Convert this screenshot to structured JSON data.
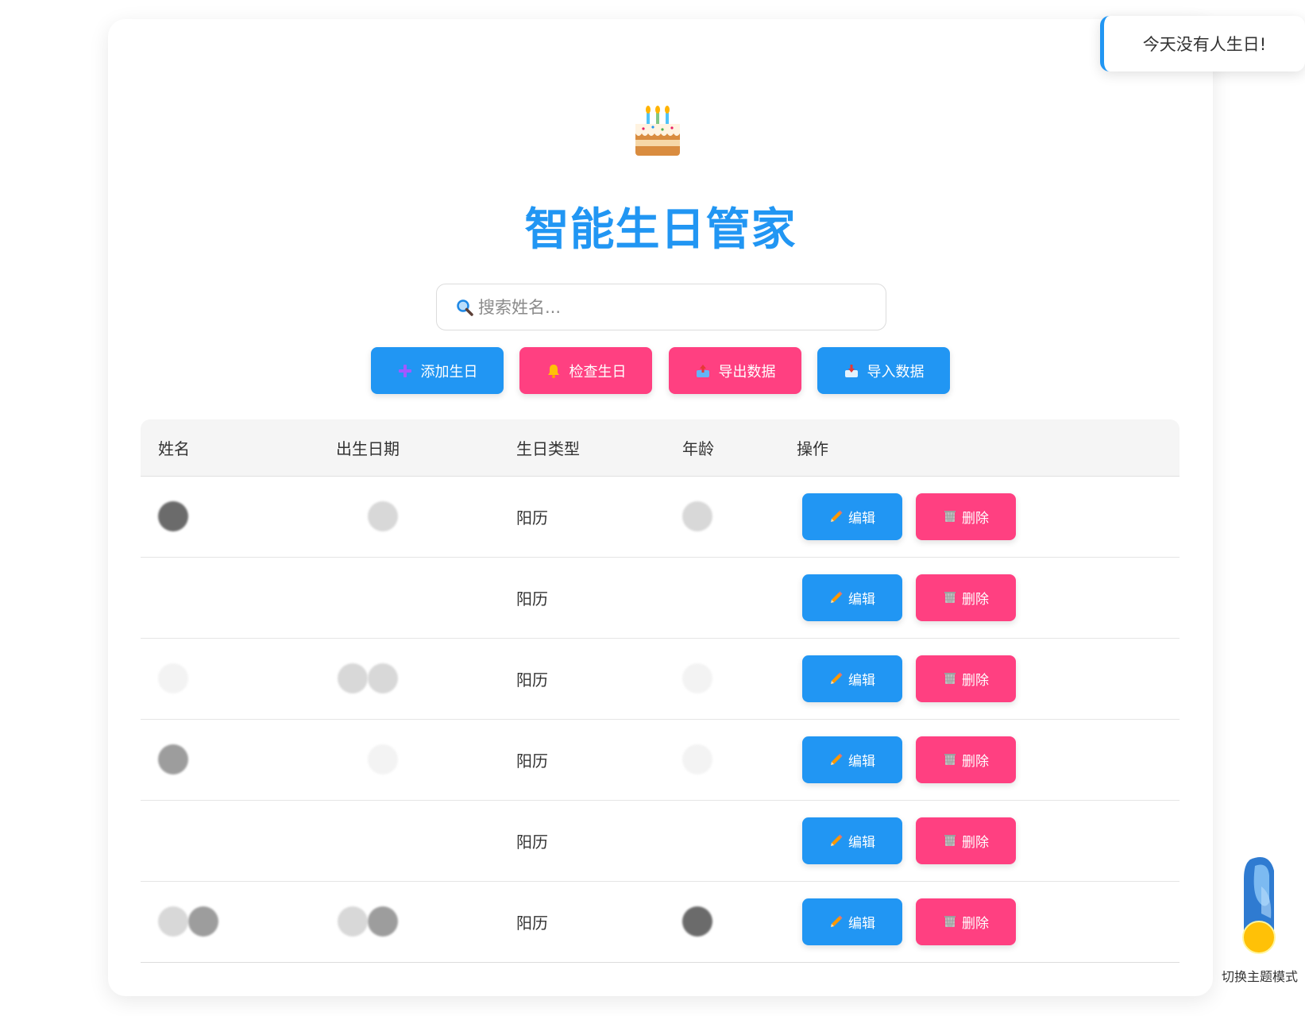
{
  "app": {
    "title": "智能生日管家",
    "logo_icon": "birthday-cake-icon"
  },
  "search": {
    "placeholder": "搜索姓名...",
    "value": "",
    "icon": "magnifier-icon"
  },
  "toolbar": {
    "add_label": "添加生日",
    "check_label": "检查生日",
    "export_label": "导出数据",
    "import_label": "导入数据"
  },
  "table": {
    "headers": {
      "name": "姓名",
      "birth_date": "出生日期",
      "type": "生日类型",
      "age": "年龄",
      "actions": "操作"
    },
    "rows": [
      {
        "type": "阳历",
        "edit": "编辑",
        "delete": "删除"
      },
      {
        "type": "阳历",
        "edit": "编辑",
        "delete": "删除"
      },
      {
        "type": "阳历",
        "edit": "编辑",
        "delete": "删除"
      },
      {
        "type": "阳历",
        "edit": "编辑",
        "delete": "删除"
      },
      {
        "type": "阳历",
        "edit": "编辑",
        "delete": "删除"
      },
      {
        "type": "阳历",
        "edit": "编辑",
        "delete": "删除"
      }
    ]
  },
  "toast": {
    "message": "今天没有人生日!"
  },
  "theme_toggle": {
    "label": "切换主题模式"
  },
  "colors": {
    "primary": "#2196f3",
    "accent": "#ff4081"
  }
}
